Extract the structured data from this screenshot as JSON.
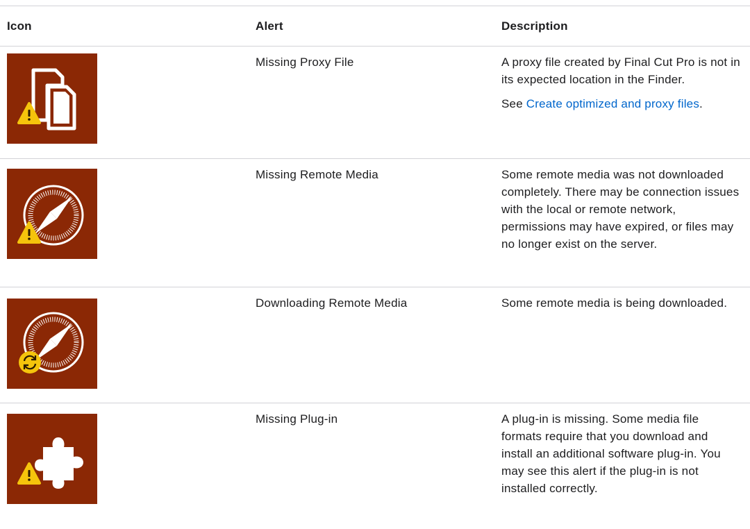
{
  "table": {
    "headers": {
      "icon": "Icon",
      "alert": "Alert",
      "description": "Description"
    },
    "rows": [
      {
        "icon": "missing-proxy-file-icon",
        "alert": "Missing Proxy File",
        "description": "A proxy file created by Final Cut Pro is not in its expected location in the Finder.",
        "see_prefix": "See ",
        "link_text": "Create optimized and proxy files",
        "see_suffix": "."
      },
      {
        "icon": "missing-remote-media-icon",
        "alert": "Missing Remote Media",
        "description": "Some remote media was not downloaded completely. There may be connection issues with the local or remote network, permissions may have expired, or files may no longer exist on the server."
      },
      {
        "icon": "downloading-remote-media-icon",
        "alert": "Downloading Remote Media",
        "description": "Some remote media is being downloaded."
      },
      {
        "icon": "missing-plug-in-icon",
        "alert": "Missing Plug-in",
        "description": "A plug-in is missing. Some media file formats require that you download and install an additional software plug-in. You may see this alert if the plug-in is not installed correctly."
      }
    ]
  },
  "colors": {
    "icon_background": "#8b2805",
    "warning_yellow": "#f5c40c",
    "link": "#0066cc",
    "rule": "#d2d2d7"
  }
}
